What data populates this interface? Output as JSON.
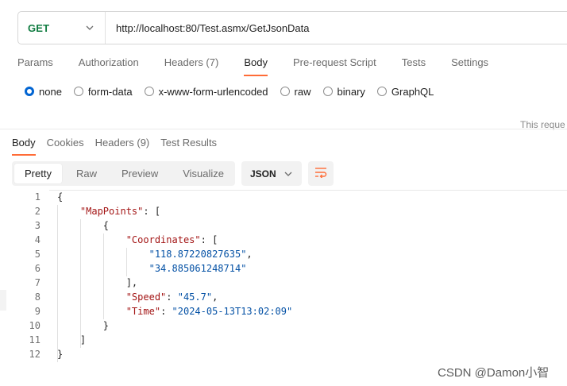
{
  "request": {
    "method": "GET",
    "url": "http://localhost:80/Test.asmx/GetJsonData"
  },
  "request_tabs": [
    {
      "label": "Params",
      "active": false
    },
    {
      "label": "Authorization",
      "active": false
    },
    {
      "label": "Headers (7)",
      "active": false
    },
    {
      "label": "Body",
      "active": true
    },
    {
      "label": "Pre-request Script",
      "active": false
    },
    {
      "label": "Tests",
      "active": false
    },
    {
      "label": "Settings",
      "active": false
    }
  ],
  "body_types": [
    {
      "label": "none",
      "checked": true
    },
    {
      "label": "form-data",
      "checked": false
    },
    {
      "label": "x-www-form-urlencoded",
      "checked": false
    },
    {
      "label": "raw",
      "checked": false
    },
    {
      "label": "binary",
      "checked": false
    },
    {
      "label": "GraphQL",
      "checked": false
    }
  ],
  "request_note": "This reque",
  "response_tabs": [
    {
      "label": "Body",
      "active": true
    },
    {
      "label": "Cookies",
      "active": false
    },
    {
      "label": "Headers (9)",
      "active": false
    },
    {
      "label": "Test Results",
      "active": false
    }
  ],
  "view_modes": [
    {
      "label": "Pretty",
      "active": true
    },
    {
      "label": "Raw",
      "active": false
    },
    {
      "label": "Preview",
      "active": false
    },
    {
      "label": "Visualize",
      "active": false
    }
  ],
  "format": "JSON",
  "code_lines": [
    {
      "num": "1",
      "tokens": [
        {
          "t": "punc",
          "v": "{"
        }
      ]
    },
    {
      "num": "2",
      "tokens": [
        {
          "t": "punc",
          "v": "    "
        },
        {
          "t": "key",
          "v": "\"MapPoints\""
        },
        {
          "t": "punc",
          "v": ": ["
        }
      ]
    },
    {
      "num": "3",
      "tokens": [
        {
          "t": "punc",
          "v": "        {"
        }
      ]
    },
    {
      "num": "4",
      "tokens": [
        {
          "t": "punc",
          "v": "            "
        },
        {
          "t": "key",
          "v": "\"Coordinates\""
        },
        {
          "t": "punc",
          "v": ": ["
        }
      ]
    },
    {
      "num": "5",
      "tokens": [
        {
          "t": "punc",
          "v": "                "
        },
        {
          "t": "str",
          "v": "\"118.87220827635\""
        },
        {
          "t": "punc",
          "v": ","
        }
      ]
    },
    {
      "num": "6",
      "tokens": [
        {
          "t": "punc",
          "v": "                "
        },
        {
          "t": "str",
          "v": "\"34.885061248714\""
        }
      ]
    },
    {
      "num": "7",
      "tokens": [
        {
          "t": "punc",
          "v": "            ],"
        }
      ]
    },
    {
      "num": "8",
      "tokens": [
        {
          "t": "punc",
          "v": "            "
        },
        {
          "t": "key",
          "v": "\"Speed\""
        },
        {
          "t": "punc",
          "v": ": "
        },
        {
          "t": "str",
          "v": "\"45.7\""
        },
        {
          "t": "punc",
          "v": ","
        }
      ]
    },
    {
      "num": "9",
      "tokens": [
        {
          "t": "punc",
          "v": "            "
        },
        {
          "t": "key",
          "v": "\"Time\""
        },
        {
          "t": "punc",
          "v": ": "
        },
        {
          "t": "str",
          "v": "\"2024-05-13T13:02:09\""
        }
      ]
    },
    {
      "num": "10",
      "tokens": [
        {
          "t": "punc",
          "v": "        }"
        }
      ]
    },
    {
      "num": "11",
      "tokens": [
        {
          "t": "punc",
          "v": "    ]"
        }
      ]
    },
    {
      "num": "12",
      "tokens": [
        {
          "t": "punc",
          "v": "}"
        }
      ]
    }
  ],
  "watermark": "CSDN @Damon小智",
  "colors": {
    "method": "#107c41",
    "accent": "#ff6c37",
    "radio_checked": "#0265d2",
    "json_key": "#a31515",
    "json_string": "#0451a5"
  }
}
